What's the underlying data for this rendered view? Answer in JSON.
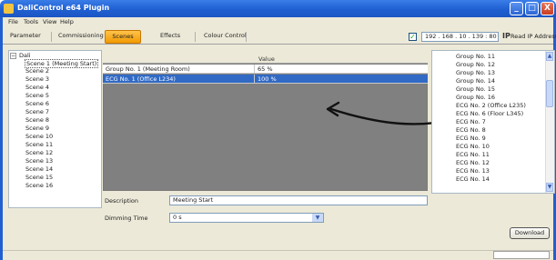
{
  "window": {
    "title": "DaliControl e64 Plugin",
    "buttons": {
      "minimize": "_",
      "maximize": "□",
      "close": "X"
    }
  },
  "menu": [
    "File",
    "Tools",
    "View",
    "Help"
  ],
  "tabs": [
    {
      "label": "Parameter",
      "active": false
    },
    {
      "label": "Commissioning",
      "active": false
    },
    {
      "label": "Scenes",
      "active": true
    },
    {
      "label": "Effects",
      "active": false
    },
    {
      "label": "Colour Control",
      "active": false
    }
  ],
  "ip": {
    "checked": true,
    "value": "192 . 168 . 10 . 139 : 80",
    "label": "Read IP Address"
  },
  "tree": {
    "root": "Dali",
    "items": [
      "Scene 1 (Meeting Start)",
      "Scene 2",
      "Scene 3",
      "Scene 4",
      "Scene 5",
      "Scene 6",
      "Scene 7",
      "Scene 8",
      "Scene 9",
      "Scene 10",
      "Scene 11",
      "Scene 12",
      "Scene 13",
      "Scene 14",
      "Scene 15",
      "Scene 16"
    ],
    "selected_index": 0
  },
  "grid": {
    "column_value": "Value",
    "rows": [
      {
        "name": "Group No. 1 (Meeting Room)",
        "value": "65 %",
        "selected": false
      },
      {
        "name": "ECG No. 1 (Office L234)",
        "value": "100 %",
        "selected": true
      }
    ]
  },
  "right_list": {
    "items": [
      "Group No. 11",
      "Group No. 12",
      "Group No. 13",
      "Group No. 14",
      "Group No. 15",
      "Group No. 16",
      "ECG No. 2 (Office L235)",
      "ECG No. 6 (Floor L345)",
      "ECG No. 7",
      "ECG No. 8",
      "ECG No. 9",
      "ECG No. 10",
      "ECG No. 11",
      "ECG No. 12",
      "ECG No. 13",
      "ECG No. 14"
    ]
  },
  "form": {
    "description_label": "Description",
    "description_value": "Meeting Start",
    "dimming_label": "Dimming Time",
    "dimming_value": "0 s"
  },
  "buttons": {
    "download": "Download"
  }
}
